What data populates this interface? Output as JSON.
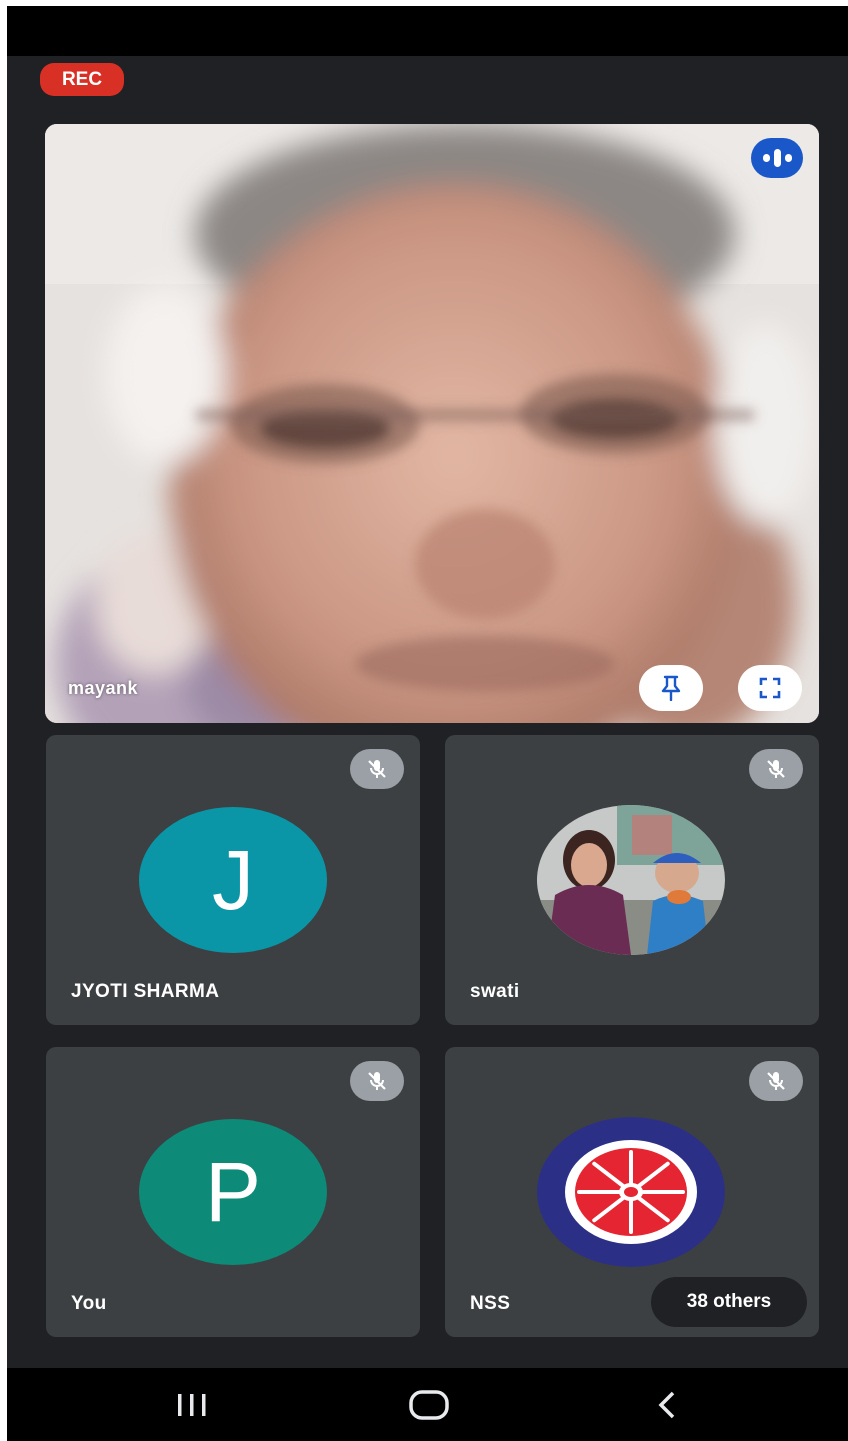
{
  "recording": {
    "label": "REC",
    "color": "#d93025"
  },
  "main_tile": {
    "name": "mayank",
    "indicator_icon": "speaking-indicator-icon",
    "buttons": [
      {
        "icon": "pin-icon"
      },
      {
        "icon": "fullscreen-icon"
      }
    ]
  },
  "participants": [
    {
      "name": "JYOTI  SHARMA",
      "avatar_letter": "J",
      "avatar_color": "#0b96a7",
      "muted": true
    },
    {
      "name": "swati",
      "avatar_type": "photo",
      "muted": true
    },
    {
      "name": "You",
      "avatar_letter": "P",
      "avatar_color": "#0d8a78",
      "muted": true
    },
    {
      "name": "NSS",
      "avatar_type": "logo",
      "muted": true
    }
  ],
  "others_count": {
    "label": "38 others"
  },
  "nav": {
    "icons": [
      "recent-apps-icon",
      "home-icon",
      "back-icon"
    ]
  },
  "colors": {
    "background": "#202124",
    "tile": "#3c4043",
    "speaking": "#1a57c9",
    "mute_badge": "#9aa0a6"
  }
}
